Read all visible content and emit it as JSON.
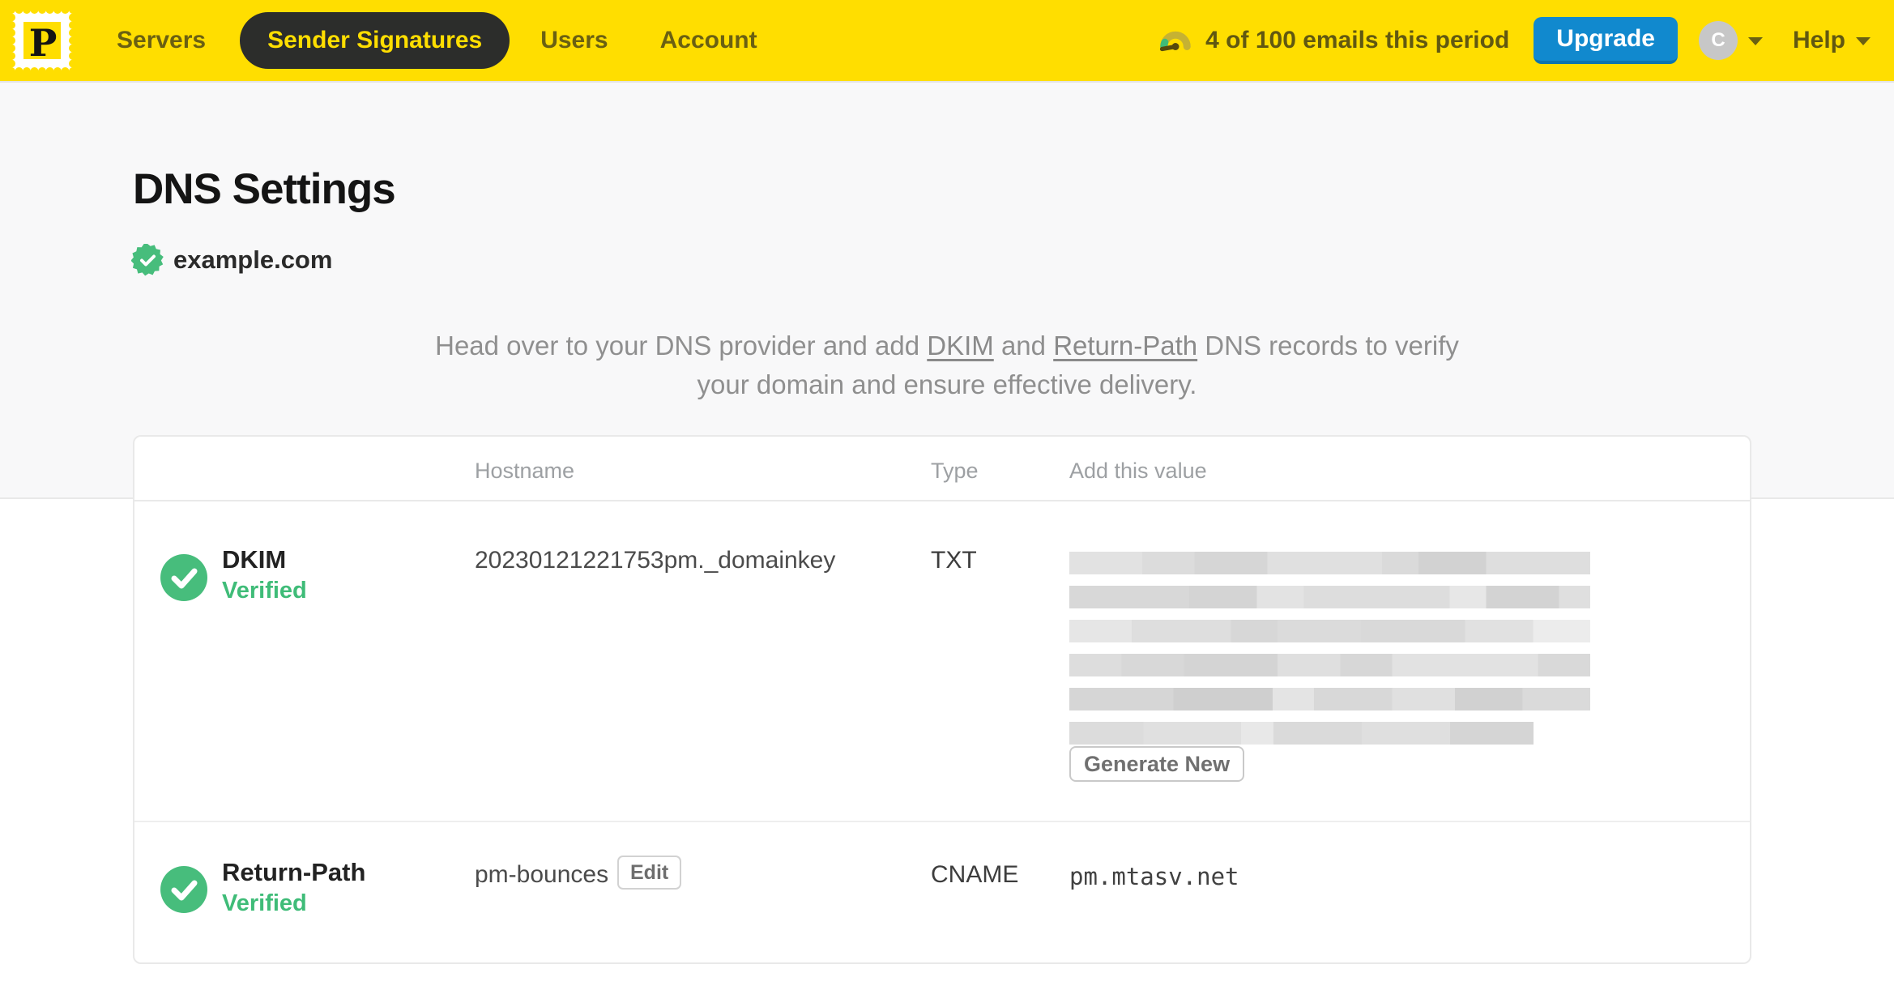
{
  "nav": {
    "logo_letter": "P",
    "items": [
      {
        "label": "Servers",
        "active": false
      },
      {
        "label": "Sender Signatures",
        "active": true
      },
      {
        "label": "Users",
        "active": false
      },
      {
        "label": "Account",
        "active": false
      }
    ],
    "usage_text": "4 of 100 emails this period",
    "upgrade_label": "Upgrade",
    "avatar_initial": "C",
    "help_label": "Help"
  },
  "page": {
    "title": "DNS Settings",
    "domain": "example.com",
    "domain_status": "verified",
    "intro": {
      "part1": "Head over to your DNS provider and add ",
      "link_dkim": "DKIM",
      "part2": " and ",
      "link_return_path": "Return-Path",
      "part3": " DNS records to verify your domain and ensure effective delivery."
    }
  },
  "table": {
    "headers": {
      "hostname": "Hostname",
      "type": "Type",
      "value": "Add this value"
    },
    "rows": [
      {
        "name": "DKIM",
        "status": "Verified",
        "hostname": "20230121221753pm._domainkey",
        "type": "TXT",
        "value_redacted": true,
        "action_label": "Generate New"
      },
      {
        "name": "Return-Path",
        "status": "Verified",
        "hostname": "pm-bounces",
        "edit_label": "Edit",
        "type": "CNAME",
        "value": "pm.mtasv.net"
      }
    ]
  },
  "colors": {
    "brand_yellow": "#FFDE00",
    "nav_active_bg": "#2C2D2B",
    "upgrade_blue": "#1189CE",
    "verified_green": "#3FBC78"
  }
}
